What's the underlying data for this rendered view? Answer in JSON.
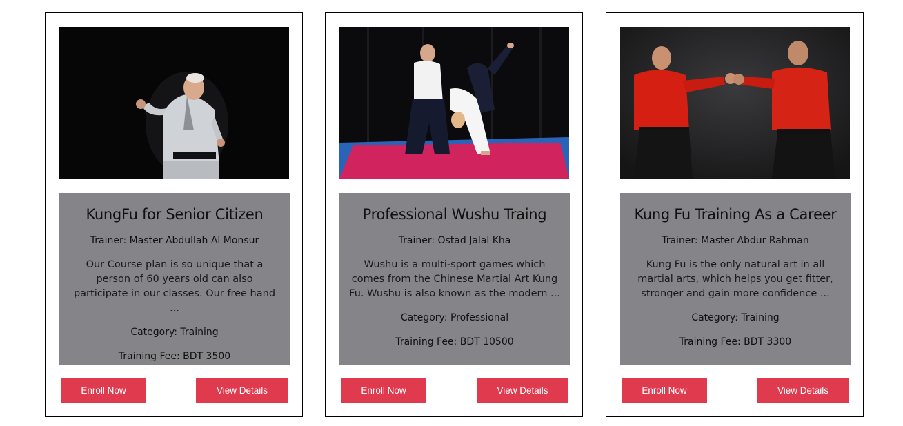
{
  "cards": [
    {
      "title": "KungFu for Senior Citizen",
      "trainer": "Trainer: Master Abdullah Al Monsur",
      "description": "Our Course plan is so unique that a person of 60 years old can also participate in our classes. Our free hand ...",
      "category": "Category: Training",
      "fee": "Training Fee: BDT 3500",
      "enroll_label": "Enroll Now",
      "details_label": "View Details"
    },
    {
      "title": "Professional Wushu Traing",
      "trainer": "Trainer: Ostad Jalal Kha",
      "description": "Wushu is a multi-sport games which comes from the Chinese Martial Art Kung Fu. Wushu is also known as the modern ...",
      "category": "Category: Professional",
      "fee": "Training Fee: BDT 10500",
      "enroll_label": "Enroll Now",
      "details_label": "View Details"
    },
    {
      "title": "Kung Fu Training As a Career",
      "trainer": "Trainer: Master Abdur Rahman",
      "description": "Kung Fu is the only natural art in all martial arts, which helps you get fitter, stronger and gain more confidence ...",
      "category": "Category: Training",
      "fee": "Training Fee: BDT 3300",
      "enroll_label": "Enroll Now",
      "details_label": "View Details"
    }
  ],
  "colors": {
    "button": "#df3a4e",
    "info_panel": "#848489"
  }
}
